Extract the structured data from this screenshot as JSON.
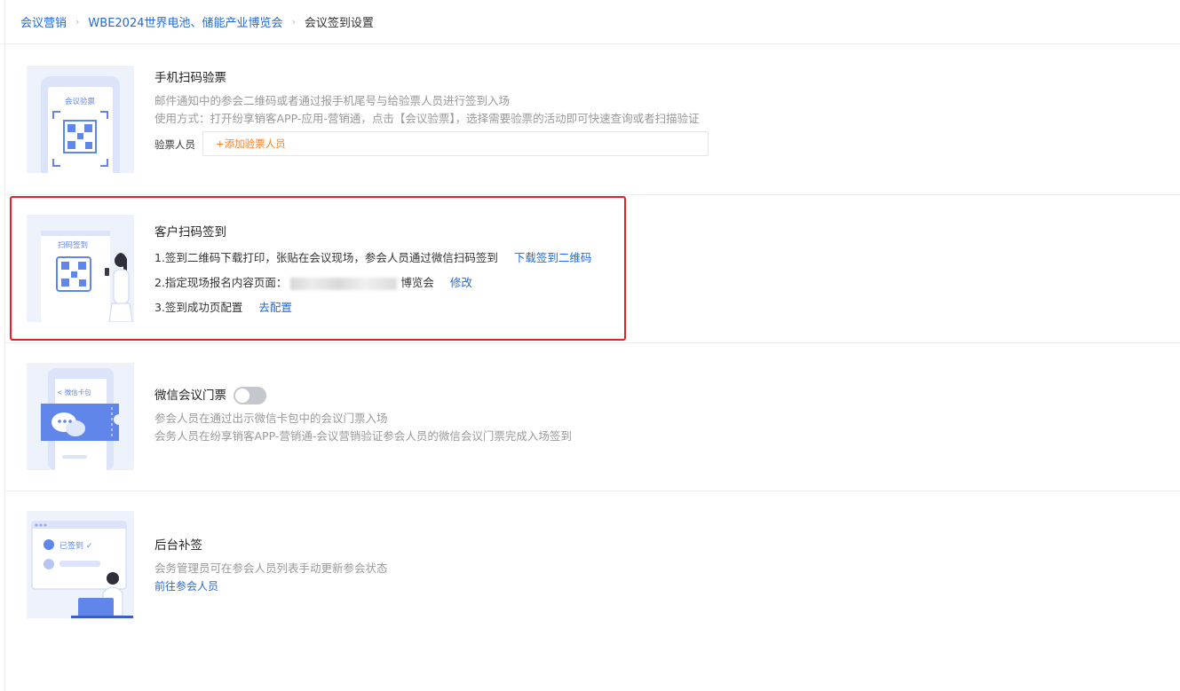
{
  "breadcrumb": {
    "items": [
      "会议营销",
      "WBE2024世界电池、储能产业博览会",
      "会议签到设置"
    ],
    "separator": "›"
  },
  "sections": [
    {
      "title": "手机扫码验票",
      "image_label": "会议验票",
      "desc": [
        "邮件通知中的参会二维码或者通过报手机尾号与给验票人员进行签到入场",
        "使用方式：打开纷享销客APP-应用-营销通，点击【会议验票】，选择需要验票的活动即可快速查询或者扫描验证"
      ],
      "field_label": "验票人员",
      "field_placeholder": "+添加验票人员"
    },
    {
      "title": "客户扫码签到",
      "image_label": "扫码签到",
      "line1_text": "1.签到二维码下载打印，张贴在会议现场，参会人员通过微信扫码签到",
      "line1_link": "下载签到二维码",
      "line2_prefix": "2.指定现场报名内容页面：",
      "line2_visible_suffix": "博览会",
      "line2_link": "修改",
      "line3_text": "3.签到成功页配置",
      "line3_link": "去配置"
    },
    {
      "title": "微信会议门票",
      "image_label": "< 微信卡包",
      "toggle_on": false,
      "desc": [
        "参会人员在通过出示微信卡包中的会议门票入场",
        "会务人员在纷享销客APP-营销通-会议营销验证参会人员的微信会议门票完成入场签到"
      ]
    },
    {
      "title": "后台补签",
      "image_label": "已签到 ✓",
      "desc": [
        "会务管理员可在参会人员列表手动更新参会状态"
      ],
      "link": "前往参会人员"
    }
  ],
  "colors": {
    "accent": "#1f6ad6",
    "orange": "#ff7f1f",
    "highlight": "#e02424",
    "illustration": "#5f86e8"
  }
}
